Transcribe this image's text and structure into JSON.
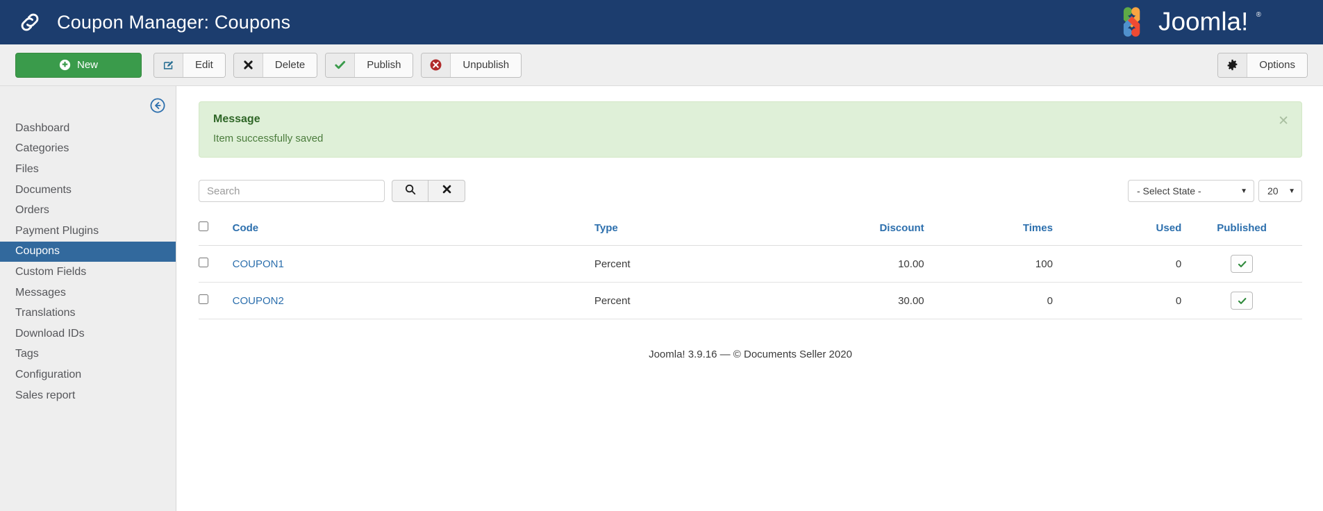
{
  "header": {
    "title": "Coupon Manager: Coupons",
    "icon": "link-icon",
    "brand": "Joomla!",
    "brand_trademark": "®",
    "bg_color": "#1c3d6e"
  },
  "toolbar": {
    "new_label": "New",
    "new_icon": "plus-circle-icon",
    "edit_label": "Edit",
    "edit_icon": "pencil-square-icon",
    "delete_label": "Delete",
    "delete_icon": "x-icon",
    "publish_label": "Publish",
    "publish_icon": "check-icon",
    "unpublish_label": "Unpublish",
    "unpublish_icon": "x-circle-icon",
    "options_label": "Options",
    "options_icon": "gear-icon",
    "new_color": "#3a9b4b"
  },
  "sidebar": {
    "collapse_icon": "arrow-circle-left-icon",
    "items": [
      {
        "label": "Dashboard",
        "active": false
      },
      {
        "label": "Categories",
        "active": false
      },
      {
        "label": "Files",
        "active": false
      },
      {
        "label": "Documents",
        "active": false
      },
      {
        "label": "Orders",
        "active": false
      },
      {
        "label": "Payment Plugins",
        "active": false
      },
      {
        "label": "Coupons",
        "active": true
      },
      {
        "label": "Custom Fields",
        "active": false
      },
      {
        "label": "Messages",
        "active": false
      },
      {
        "label": "Translations",
        "active": false
      },
      {
        "label": "Download IDs",
        "active": false
      },
      {
        "label": "Tags",
        "active": false
      },
      {
        "label": "Configuration",
        "active": false
      },
      {
        "label": "Sales report",
        "active": false
      }
    ],
    "active_color": "#32699d"
  },
  "alert": {
    "title": "Message",
    "text": "Item successfully saved",
    "close_icon": "close-icon",
    "bg_color": "#dff0d8",
    "text_color": "#2f6627"
  },
  "filters": {
    "search_placeholder": "Search",
    "search_value": "",
    "search_icon": "search-icon",
    "clear_icon": "x-icon",
    "state_select": "- Select State -",
    "limit_select": "20",
    "caret_icon": "chevron-down-icon"
  },
  "table": {
    "columns": [
      "Code",
      "Type",
      "Discount",
      "Times",
      "Used",
      "Published"
    ],
    "rows": [
      {
        "code": "COUPON1",
        "type": "Percent",
        "discount": "10.00",
        "times": "100",
        "used": "0",
        "published": true
      },
      {
        "code": "COUPON2",
        "type": "Percent",
        "discount": "30.00",
        "times": "0",
        "used": "0",
        "published": true
      }
    ],
    "published_icon": "check-icon"
  },
  "footer": {
    "text": "Joomla! 3.9.16  —  © Documents Seller 2020"
  }
}
